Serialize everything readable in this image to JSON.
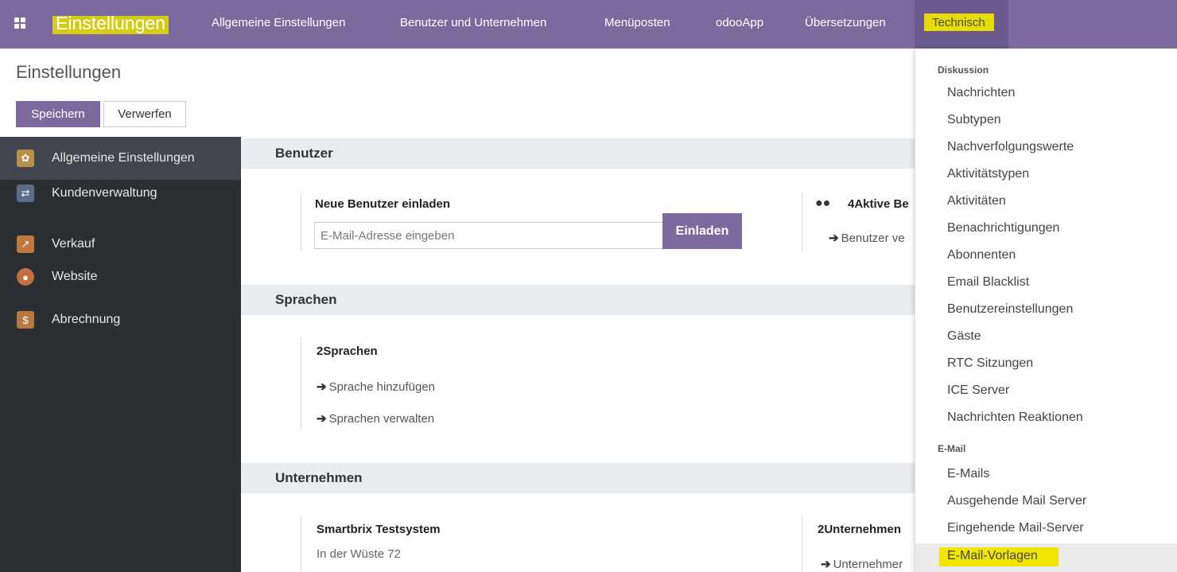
{
  "navbar": {
    "brand": "Einstellungen",
    "items": [
      "Allgemeine Einstellungen",
      "Benutzer und Unternehmen",
      "Menüposten",
      "odooApp",
      "Übersetzungen"
    ],
    "active": "Technisch"
  },
  "control": {
    "title": "Einstellungen",
    "save": "Speichern",
    "discard": "Verwerfen"
  },
  "sidebar": {
    "items": [
      {
        "label": "Allgemeine Einstellungen",
        "icon": "gear-icon",
        "color": "#b4904a"
      },
      {
        "label": "Kundenverwaltung",
        "icon": "handshake-icon",
        "color": "#5b6b8a"
      },
      {
        "label": "Verkauf",
        "icon": "chart-icon",
        "color": "#c1773c"
      },
      {
        "label": "Website",
        "icon": "globe-icon",
        "color": "#c56d40"
      },
      {
        "label": "Abrechnung",
        "icon": "invoice-icon",
        "color": "#b57a42"
      }
    ]
  },
  "users": {
    "title": "Benutzer",
    "invite_label": "Neue Benutzer einladen",
    "email_placeholder": "E-Mail-Adresse eingeben",
    "invite_button": "Einladen",
    "active_users": "4Aktive Be",
    "manage_users": "Benutzer ve"
  },
  "languages": {
    "title": "Sprachen",
    "count": "2Sprachen",
    "add": "Sprache hinzufügen",
    "manage": "Sprachen verwalten"
  },
  "companies": {
    "title": "Unternehmen",
    "name": "Smartbrix Testsystem",
    "address": "In der Wüste 72",
    "count": "2Unternehmen",
    "manage": "Unternehmer"
  },
  "dropdown": {
    "section1": "Diskussion",
    "items1": [
      "Nachrichten",
      "Subtypen",
      "Nachverfolgungswerte",
      "Aktivitätstypen",
      "Aktivitäten",
      "Benachrichtigungen",
      "Abonnenten",
      "Email Blacklist",
      "Benutzereinstellungen",
      "Gäste",
      "RTC Sitzungen",
      "ICE Server",
      "Nachrichten Reaktionen"
    ],
    "section2": "E-Mail",
    "items2": [
      "E-Mails",
      "Ausgehende Mail Server",
      "Eingehende Mail-Server",
      "E-Mail-Vorlagen"
    ]
  }
}
